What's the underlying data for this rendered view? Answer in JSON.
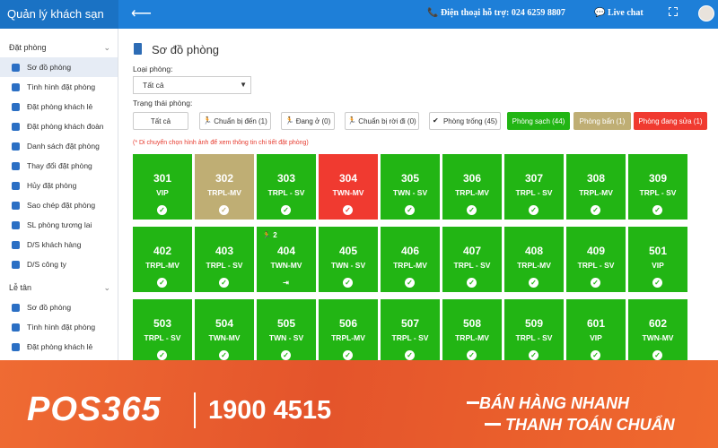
{
  "header": {
    "app_title": "Quản lý khách sạn",
    "hotline": "📞 Điện thoại hỗ trợ: 024 6259 8807",
    "livechat": "💬 Live chat"
  },
  "sidebar": {
    "section1": "Đặt phòng",
    "items1": [
      "Sơ đồ phòng",
      "Tình hình đặt phòng",
      "Đặt phòng khách lẻ",
      "Đặt phòng khách đoàn",
      "Danh sách đặt phòng",
      "Thay đổi đặt phòng",
      "Hủy đặt phòng",
      "Sao chép đặt phòng",
      "SL phòng tương lai",
      "D/S khách hàng",
      "D/S công ty"
    ],
    "section2": "Lễ tân",
    "items2": [
      "Sơ đồ phòng",
      "Tình hình đặt phòng",
      "Đặt phòng khách lẻ"
    ]
  },
  "main": {
    "title": "Sơ đồ phòng",
    "room_type_label": "Loại phòng:",
    "room_type_value": "Tất cả",
    "status_label": "Trạng thái phòng:",
    "filters": [
      "Tất cả",
      "Chuẩn bị đến (1)",
      "Đang ở (0)",
      "Chuẩn bị rời đi (0)",
      "Phòng trống (45)",
      "Phòng sạch (44)",
      "Phòng bẩn (1)",
      "Phòng đang sửa (1)"
    ],
    "hint": "(* Di chuyển chọn hình ảnh để xem thông tin chi tiết đặt phòng)"
  },
  "rooms": [
    {
      "num": "301",
      "type": "VIP",
      "state": "clean"
    },
    {
      "num": "302",
      "type": "TRPL-MV",
      "state": "dirty"
    },
    {
      "num": "303",
      "type": "TRPL - SV",
      "state": "clean"
    },
    {
      "num": "304",
      "type": "TWN-MV",
      "state": "repair"
    },
    {
      "num": "305",
      "type": "TWN - SV",
      "state": "clean"
    },
    {
      "num": "306",
      "type": "TRPL-MV",
      "state": "clean"
    },
    {
      "num": "307",
      "type": "TRPL - SV",
      "state": "clean"
    },
    {
      "num": "308",
      "type": "TRPL-MV",
      "state": "clean"
    },
    {
      "num": "309",
      "type": "TRPL - SV",
      "state": "clean"
    },
    {
      "num": "402",
      "type": "TRPL-MV",
      "state": "clean"
    },
    {
      "num": "403",
      "type": "TRPL - SV",
      "state": "clean"
    },
    {
      "num": "404",
      "type": "TWN-MV",
      "state": "clean",
      "guest": "2"
    },
    {
      "num": "405",
      "type": "TWN - SV",
      "state": "clean"
    },
    {
      "num": "406",
      "type": "TRPL-MV",
      "state": "clean"
    },
    {
      "num": "407",
      "type": "TRPL - SV",
      "state": "clean"
    },
    {
      "num": "408",
      "type": "TRPL-MV",
      "state": "clean"
    },
    {
      "num": "409",
      "type": "TRPL - SV",
      "state": "clean"
    },
    {
      "num": "501",
      "type": "VIP",
      "state": "clean"
    },
    {
      "num": "503",
      "type": "TRPL - SV",
      "state": "clean"
    },
    {
      "num": "504",
      "type": "TWN-MV",
      "state": "clean"
    },
    {
      "num": "505",
      "type": "TWN - SV",
      "state": "clean"
    },
    {
      "num": "506",
      "type": "TRPL-MV",
      "state": "clean"
    },
    {
      "num": "507",
      "type": "TRPL - SV",
      "state": "clean"
    },
    {
      "num": "508",
      "type": "TRPL-MV",
      "state": "clean"
    },
    {
      "num": "509",
      "type": "TRPL - SV",
      "state": "clean"
    },
    {
      "num": "601",
      "type": "VIP",
      "state": "clean"
    },
    {
      "num": "602",
      "type": "TWN-MV",
      "state": "clean"
    }
  ],
  "banner": {
    "logo": "POS365",
    "phone": "1900 4515",
    "slogan1": "BÁN HÀNG NHANH",
    "slogan2": "THANH TOÁN CHUẨN"
  },
  "colors": {
    "clean": "#22b514",
    "dirty": "#bfae74",
    "repair": "#f03a30",
    "header": "#1e7fd8"
  }
}
